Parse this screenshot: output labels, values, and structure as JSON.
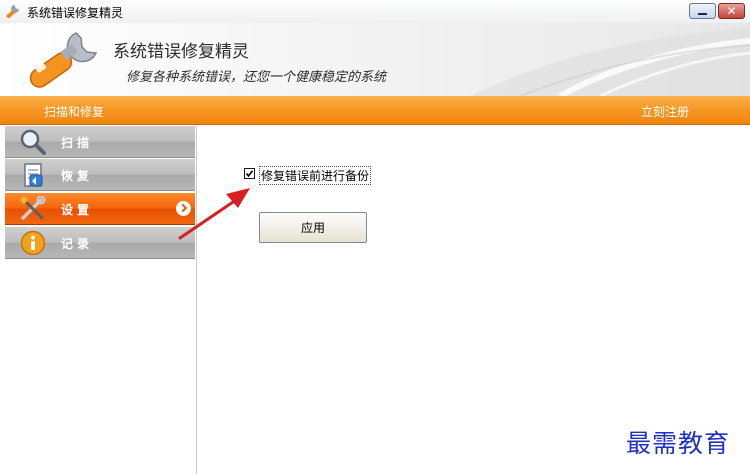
{
  "window": {
    "title": "系统错误修复精灵",
    "icon": "wrench-app-icon",
    "controls": [
      "minimize",
      "close"
    ]
  },
  "header": {
    "title": "系统错误修复精灵",
    "subtitle": "修复各种系统错误，还您一个健康稳定的系统",
    "logo_icon": "wrench-logo-icon"
  },
  "topbar": {
    "tab_label": "扫描和修复",
    "register_link": "立刻注册"
  },
  "sidebar": {
    "items": [
      {
        "label": "扫描",
        "icon": "magnifier-icon",
        "active": false
      },
      {
        "label": "恢复",
        "icon": "restore-document-icon",
        "active": false
      },
      {
        "label": "设置",
        "icon": "tools-icon",
        "active": true
      },
      {
        "label": "记录",
        "icon": "info-icon",
        "active": false
      }
    ]
  },
  "settings": {
    "backup_checkbox_label": "修复错误前进行备份",
    "backup_checked": true,
    "apply_label": "应用"
  },
  "watermark": "最需教育",
  "colors": {
    "accent_orange": "#f5941f",
    "active_item": "#f06810",
    "inactive_item": "#b7b7b7",
    "annotation_arrow": "#d91f1f",
    "watermark": "#2030c0"
  }
}
